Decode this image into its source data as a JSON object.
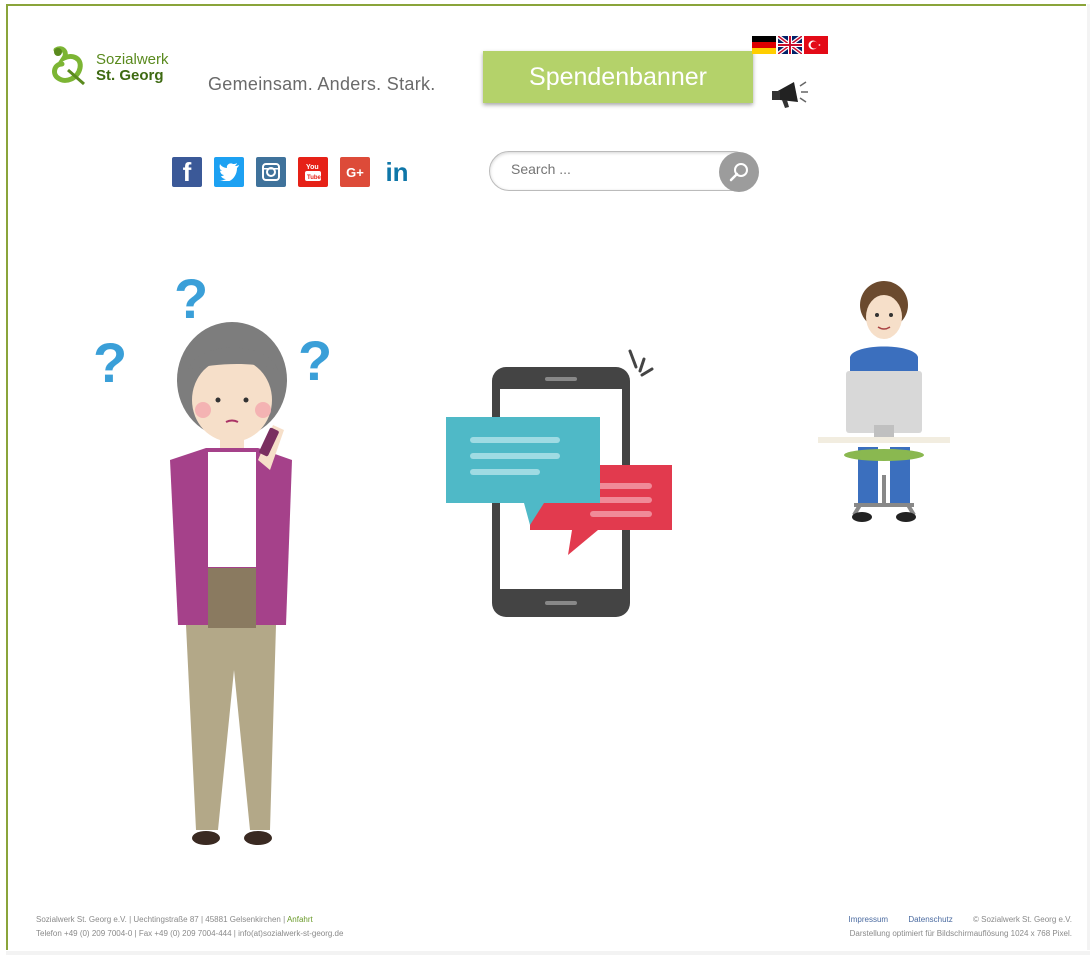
{
  "header": {
    "logo_line1": "Sozialwerk",
    "logo_line2": "St. Georg",
    "tagline": "Gemeinsam. Anders. Stark.",
    "spenden_label": "Spendenbanner",
    "languages": [
      "de",
      "en",
      "tr"
    ]
  },
  "social": {
    "facebook": "f",
    "twitter": "t",
    "instagram": "ig",
    "youtube": "yt",
    "googleplus": "G+",
    "linkedin": "in"
  },
  "search": {
    "placeholder": "Search ..."
  },
  "footer": {
    "address_line": "Sozialwerk St. Georg e.V. | Uechtingstraße 87 | 45881 Gelsenkirchen |",
    "anfahrt": "Anfahrt",
    "contact_line": "Telefon +49 (0) 209 7004-0 | Fax +49 (0) 209 7004-444 | info(at)sozialwerk-st-georg.de",
    "impressum": "Impressum",
    "datenschutz": "Datenschutz",
    "copyright": "© Sozialwerk St. Georg e.V.",
    "resolution_note": "Darstellung optimiert für Bildschirmauflösung 1024 x 768 Pixel."
  },
  "colors": {
    "brand_green": "#5a8a1e",
    "banner_green": "#b4d26a",
    "frame_green": "#8aa43a"
  }
}
